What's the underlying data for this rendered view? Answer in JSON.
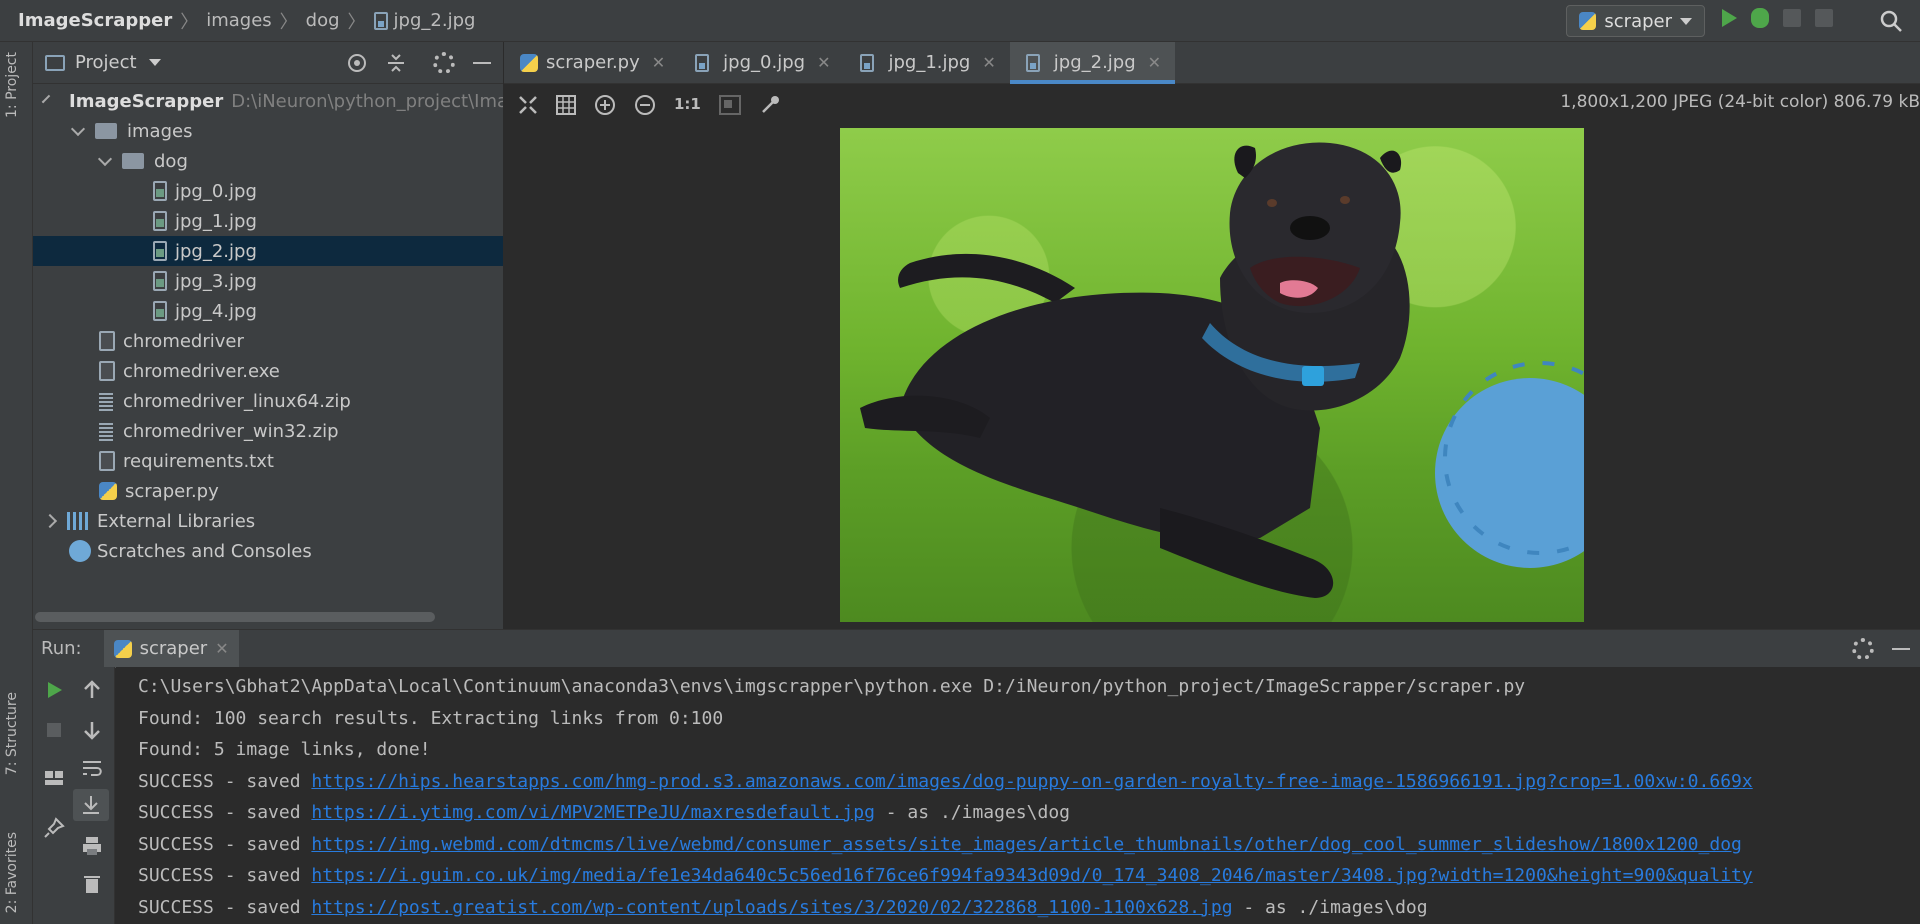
{
  "breadcrumb": {
    "project": "ImageScrapper",
    "folder1": "images",
    "folder2": "dog",
    "file": "jpg_2.jpg"
  },
  "run_config": {
    "name": "scraper"
  },
  "left_strip": {
    "project_tab": "1: Project",
    "structure_tab": "7: Structure",
    "favorites_tab": "2: Favorites"
  },
  "project_panel": {
    "title": "Project",
    "root": {
      "label": "ImageScrapper",
      "path": "D:\\iNeuron\\python_project\\ImageScrapper"
    },
    "images_folder": "images",
    "dog_folder": "dog",
    "dog_files": [
      "jpg_0.jpg",
      "jpg_1.jpg",
      "jpg_2.jpg",
      "jpg_3.jpg",
      "jpg_4.jpg"
    ],
    "root_files": [
      "chromedriver",
      "chromedriver.exe",
      "chromedriver_linux64.zip",
      "chromedriver_win32.zip",
      "requirements.txt",
      "scraper.py"
    ],
    "external_libraries": "External Libraries",
    "scratches": "Scratches and Consoles"
  },
  "editor_tabs": [
    "scraper.py",
    "jpg_0.jpg",
    "jpg_1.jpg",
    "jpg_2.jpg"
  ],
  "image_viewer": {
    "zoom_1to1": "1:1",
    "info": "1,800x1,200 JPEG (24-bit color) 806.79 kB"
  },
  "run_panel": {
    "label": "Run:",
    "tab": "scraper",
    "lines": [
      {
        "prefix": "C:\\Users\\Gbhat2\\AppData\\Local\\Continuum\\anaconda3\\envs\\imgscrapper\\python.exe D:/iNeuron/python_project/ImageScrapper/scraper.py",
        "link": "",
        "suffix": ""
      },
      {
        "prefix": "Found: 100 search results. Extracting links from 0:100",
        "link": "",
        "suffix": ""
      },
      {
        "prefix": "Found: 5 image links, done!",
        "link": "",
        "suffix": ""
      },
      {
        "prefix": "SUCCESS - saved ",
        "link": "https://hips.hearstapps.com/hmg-prod.s3.amazonaws.com/images/dog-puppy-on-garden-royalty-free-image-1586966191.jpg?crop=1.00xw:0.669x",
        "suffix": ""
      },
      {
        "prefix": "SUCCESS - saved ",
        "link": "https://i.ytimg.com/vi/MPV2METPeJU/maxresdefault.jpg",
        "suffix": " - as ./images\\dog"
      },
      {
        "prefix": "SUCCESS - saved ",
        "link": "https://img.webmd.com/dtmcms/live/webmd/consumer_assets/site_images/article_thumbnails/other/dog_cool_summer_slideshow/1800x1200_dog",
        "suffix": ""
      },
      {
        "prefix": "SUCCESS - saved ",
        "link": "https://i.guim.co.uk/img/media/fe1e34da640c5c56ed16f76ce6f994fa9343d09d/0_174_3408_2046/master/3408.jpg?width=1200&height=900&quality",
        "suffix": ""
      },
      {
        "prefix": "SUCCESS - saved ",
        "link": "https://post.greatist.com/wp-content/uploads/sites/3/2020/02/322868_1100-1100x628.jpg",
        "suffix": " - as ./images\\dog"
      }
    ]
  },
  "colors": {
    "accent": "#4a88c7",
    "link": "#287bde",
    "run_green": "#4ea64a",
    "selection": "#0d293e"
  }
}
